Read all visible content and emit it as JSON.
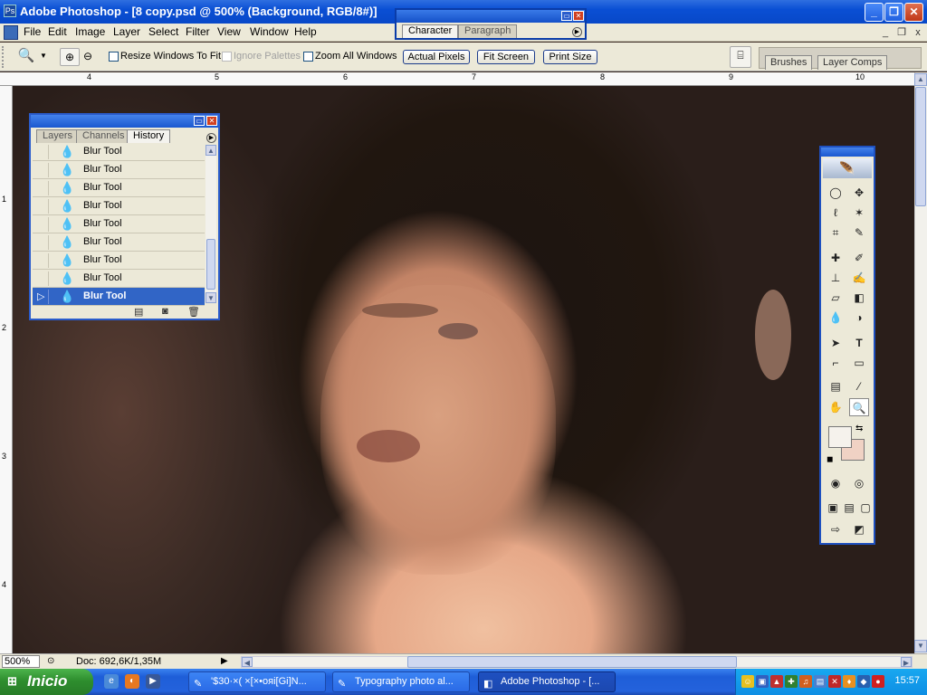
{
  "window": {
    "title": "Adobe Photoshop - [8 copy.psd @ 500% (Background, RGB/8#)]",
    "minimize": "_",
    "maximize": "❐",
    "close": "✕"
  },
  "menu": {
    "items": [
      "File",
      "Edit",
      "Image",
      "Layer",
      "Select",
      "Filter",
      "View",
      "Window",
      "Help"
    ],
    "mdi_min": "_",
    "mdi_restore": "❐",
    "mdi_close": "x"
  },
  "options": {
    "resize_windows_to_fit": "Resize Windows To Fit",
    "ignore_palettes": "Ignore Palettes",
    "zoom_all_windows": "Zoom All Windows",
    "actual_pixels": "Actual Pixels",
    "fit_screen": "Fit Screen",
    "print_size": "Print Size",
    "palette_well_tabs": [
      "Brushes",
      "Layer Comps"
    ]
  },
  "character_palette": {
    "tabs": [
      "Character",
      "Paragraph"
    ]
  },
  "rulers": {
    "top_labels": [
      "4",
      "5",
      "6",
      "7",
      "8",
      "9",
      "10"
    ],
    "left_labels": [
      "1",
      "2",
      "3",
      "4"
    ]
  },
  "history_palette": {
    "tabs": [
      "Layers",
      "Channels",
      "History"
    ],
    "items": [
      "Blur Tool",
      "Blur Tool",
      "Blur Tool",
      "Blur Tool",
      "Blur Tool",
      "Blur Tool",
      "Blur Tool",
      "Blur Tool",
      "Blur Tool"
    ],
    "selected_index": 8
  },
  "status": {
    "zoom": "500%",
    "doc": "Doc: 692,6K/1,35M"
  },
  "colors": {
    "foreground": "#f5f2ec",
    "background": "#f0d2c4"
  },
  "taskbar": {
    "start": "Inicio",
    "tasks": [
      "'$30·×( ×[×•oяi[Gi]N...",
      "Typography photo al...",
      "Adobe Photoshop - [..."
    ],
    "clock": "15:57"
  }
}
